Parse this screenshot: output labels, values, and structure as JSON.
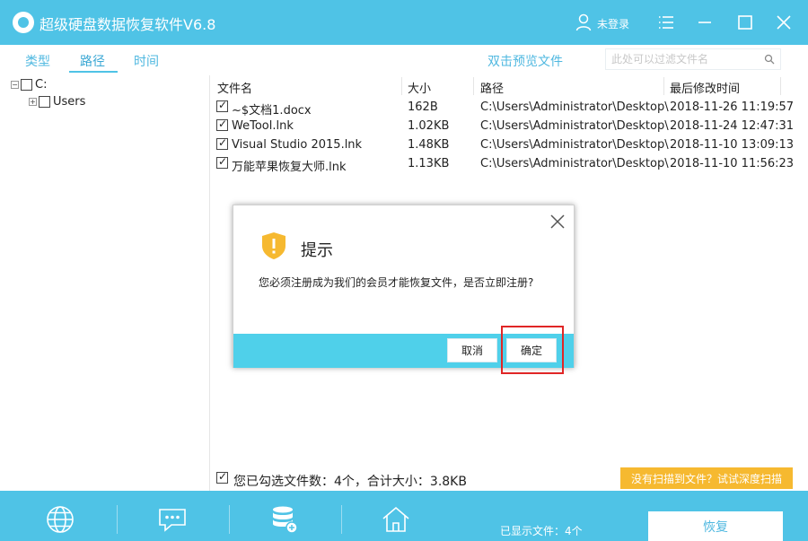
{
  "app": {
    "title": "超级硬盘数据恢复软件V6.8",
    "user_label": "未登录",
    "accent_color": "#4fc3e6"
  },
  "toolbar": {
    "tabs": [
      {
        "label": "类型",
        "active": false
      },
      {
        "label": "路径",
        "active": true
      },
      {
        "label": "时间",
        "active": false
      }
    ],
    "preview_link": "双击预览文件",
    "search_placeholder": "此处可以过滤文件名"
  },
  "tree": {
    "root": {
      "label": "C:",
      "checked": false
    },
    "children": [
      {
        "label": "Users",
        "checked": false
      }
    ]
  },
  "file_table": {
    "columns": [
      "文件名",
      "大小",
      "路径",
      "最后修改时间"
    ],
    "rows": [
      {
        "name": "~$文档1.docx",
        "size": "162B",
        "path": "C:\\Users\\Administrator\\Desktop\\",
        "modified": "2018-11-26 11:19:57",
        "checked": true
      },
      {
        "name": "WeTool.lnk",
        "size": "1.02KB",
        "path": "C:\\Users\\Administrator\\Desktop\\",
        "modified": "2018-11-24 12:47:31",
        "checked": true
      },
      {
        "name": "Visual Studio 2015.lnk",
        "size": "1.48KB",
        "path": "C:\\Users\\Administrator\\Desktop\\",
        "modified": "2018-11-10 13:09:13",
        "checked": true
      },
      {
        "name": "万能苹果恢复大师.lnk",
        "size": "1.13KB",
        "path": "C:\\Users\\Administrator\\Desktop\\",
        "modified": "2018-11-10 11:56:23",
        "checked": true
      }
    ]
  },
  "status": {
    "selected_text": "您已勾选文件数：4个，合计大小：3.8KB",
    "deep_scan_label": "没有扫描到文件？试试深度扫描"
  },
  "bottom": {
    "icons": [
      "globe-icon",
      "chat-icon",
      "database-icon",
      "home-icon"
    ],
    "shown_files": "已显示文件：4个",
    "recover_label": "恢复"
  },
  "dialog": {
    "title": "提示",
    "message": "您必须注册成为我们的会员才能恢复文件，是否立即注册?",
    "cancel_label": "取消",
    "ok_label": "确定"
  }
}
